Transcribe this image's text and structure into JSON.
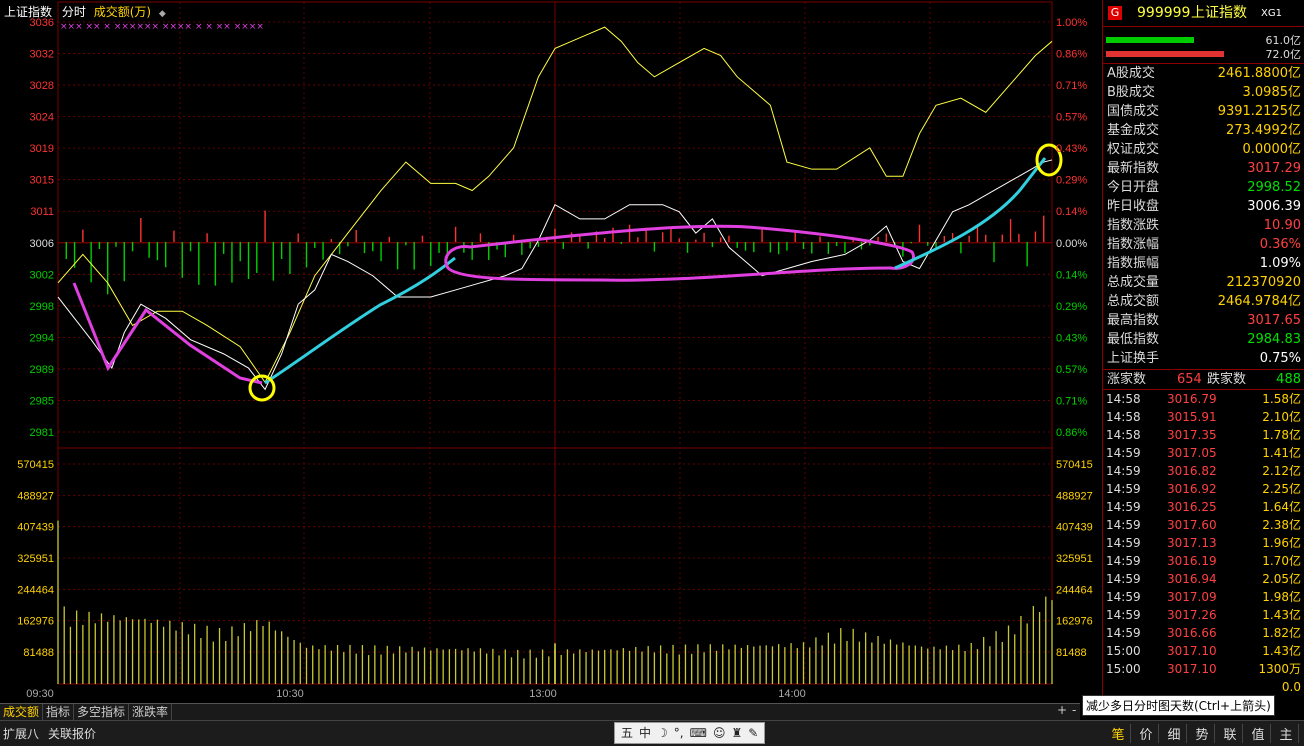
{
  "chart_header": {
    "title": "上证指数",
    "mode": "分时",
    "indicator": "成交额(万)",
    "sort_icon": "up-down-arrows-icon"
  },
  "chart_data": {
    "type": "line",
    "price_axis_ticks": [
      "3036",
      "3032",
      "3028",
      "3024",
      "3019",
      "3015",
      "3011",
      "3006",
      "3002",
      "2998",
      "2994",
      "2989",
      "2985",
      "2981"
    ],
    "pct_axis_ticks": [
      "1.00%",
      "0.86%",
      "0.71%",
      "0.57%",
      "0.43%",
      "0.29%",
      "0.14%",
      "0.00%",
      "0.14%",
      "0.29%",
      "0.43%",
      "0.57%",
      "0.71%",
      "0.86%"
    ],
    "volume_axis_ticks": [
      "570415",
      "488927",
      "407439",
      "325951",
      "244464",
      "162976",
      "81488"
    ],
    "time_labels": [
      "09:30",
      "10:30",
      "13:00",
      "14:00"
    ],
    "prev_close": 3006.39,
    "price_ylim": [
      2979,
      3037
    ],
    "volume_ylim": [
      0,
      595000
    ],
    "x_range": [
      0,
      240
    ],
    "index_line": {
      "x": [
        0,
        8,
        13,
        16,
        20,
        26,
        32,
        40,
        46,
        50,
        54,
        58,
        62,
        66,
        70,
        76,
        82,
        90,
        96,
        102,
        108,
        112,
        116,
        120,
        126,
        132,
        138,
        142,
        146,
        150,
        154,
        158,
        162,
        166,
        170,
        176,
        182,
        190,
        196,
        200,
        204,
        208,
        212,
        216,
        220,
        226,
        232,
        238,
        240
      ],
      "y": [
        2998,
        2992,
        2988,
        2993,
        2997,
        2995,
        2992,
        2990,
        2988,
        2985,
        2990,
        2997,
        2999,
        3004,
        3003,
        3001,
        2998,
        2998,
        2999,
        3000,
        3001,
        3002,
        3006,
        3011,
        3009,
        3009,
        3011,
        3011,
        3011,
        3010,
        3007,
        3009,
        3005,
        3003,
        3001,
        3002,
        3003,
        3004,
        3006,
        3008,
        3003,
        3002,
        3006,
        3010,
        3011,
        3013,
        3015,
        3017,
        3017.3
      ]
    },
    "avg_line": {
      "x": [
        0,
        6,
        12,
        18,
        24,
        30,
        36,
        44,
        50,
        56,
        62,
        70,
        78,
        84,
        90,
        96,
        100,
        104,
        110,
        116,
        120,
        124,
        128,
        132,
        136,
        140,
        144,
        150,
        156,
        160,
        164,
        168,
        172,
        176,
        182,
        188,
        196,
        200,
        204,
        208,
        212,
        218,
        224,
        230,
        236,
        240
      ],
      "y": [
        3000,
        3004,
        3000,
        2994,
        2996,
        2996,
        2994,
        2991,
        2986,
        2993,
        3001,
        3007,
        3013,
        3017,
        3014,
        3014,
        3013,
        3015,
        3019,
        3029,
        3033,
        3034,
        3035,
        3036,
        3034,
        3031,
        3029,
        3031,
        3033,
        3032,
        3029,
        3027,
        3025,
        3017,
        3016,
        3016,
        3019,
        3015,
        3015,
        3021,
        3025,
        3026,
        3024,
        3028,
        3032,
        3034
      ]
    },
    "volume_profile": {
      "x": [
        0,
        1,
        2,
        20,
        40,
        50,
        52,
        56,
        60,
        80,
        100,
        110,
        120,
        140,
        160,
        180,
        190,
        200,
        210,
        220,
        230,
        240
      ],
      "y": [
        520000,
        190000,
        175000,
        165000,
        130000,
        160000,
        145000,
        118000,
        95000,
        90000,
        88000,
        80000,
        82000,
        90000,
        95000,
        100000,
        135000,
        110000,
        92000,
        95000,
        140000,
        225000
      ]
    },
    "volume_spike": {
      "x": 120,
      "y": 110000
    },
    "breadth_bars": "oscillating red/green bars above/below 0.00% line"
  },
  "stars_row": "×××  ×× ×  ××××××  ×××× ×  ×    ××    ××××",
  "side_panel": {
    "badge": "G",
    "code": "999999",
    "name": "上证指数",
    "tag": "XG1",
    "bars": [
      {
        "value": "61.0亿",
        "color": "#00cc00"
      },
      {
        "value": "72.0亿",
        "color": "#e23232"
      }
    ],
    "stats": [
      {
        "label": "A股成交",
        "value": "2461.8800亿",
        "color": "#ffd200"
      },
      {
        "label": "B股成交",
        "value": "3.0985亿",
        "color": "#ffd200"
      },
      {
        "label": "国债成交",
        "value": "9391.2125亿",
        "color": "#ffd200"
      },
      {
        "label": "基金成交",
        "value": "273.4992亿",
        "color": "#ffd200"
      },
      {
        "label": "权证成交",
        "value": "0.0000亿",
        "color": "#ffd200"
      },
      {
        "label": "最新指数",
        "value": "3017.29",
        "color": "#ff4040"
      },
      {
        "label": "今日开盘",
        "value": "2998.52",
        "color": "#00e000"
      },
      {
        "label": "昨日收盘",
        "value": "3006.39",
        "color": "#ffffff"
      },
      {
        "label": "指数涨跌",
        "value": "10.90",
        "color": "#ff4040"
      },
      {
        "label": "指数涨幅",
        "value": "0.36%",
        "color": "#ff4040"
      },
      {
        "label": "指数振幅",
        "value": "1.09%",
        "color": "#ffffff"
      },
      {
        "label": "总成交量",
        "value": "212370920",
        "color": "#ffd200"
      },
      {
        "label": "总成交额",
        "value": "2464.9784亿",
        "color": "#ffd200"
      },
      {
        "label": "最高指数",
        "value": "3017.65",
        "color": "#ff4040"
      },
      {
        "label": "最低指数",
        "value": "2984.83",
        "color": "#00e000"
      },
      {
        "label": "上证换手",
        "value": "0.75%",
        "color": "#ffffff"
      }
    ],
    "breadth": {
      "up_label": "涨家数",
      "up_count": "654",
      "down_label": "跌家数",
      "down_count": "488"
    },
    "ticks": [
      {
        "time": "14:58",
        "price": "3016.79",
        "amount": "1.58亿"
      },
      {
        "time": "14:58",
        "price": "3015.91",
        "amount": "2.10亿"
      },
      {
        "time": "14:58",
        "price": "3017.35",
        "amount": "1.78亿"
      },
      {
        "time": "14:59",
        "price": "3017.05",
        "amount": "1.41亿"
      },
      {
        "time": "14:59",
        "price": "3016.82",
        "amount": "2.12亿"
      },
      {
        "time": "14:59",
        "price": "3016.92",
        "amount": "2.25亿"
      },
      {
        "time": "14:59",
        "price": "3016.25",
        "amount": "1.64亿"
      },
      {
        "time": "14:59",
        "price": "3017.60",
        "amount": "2.38亿"
      },
      {
        "time": "14:59",
        "price": "3017.13",
        "amount": "1.96亿"
      },
      {
        "time": "14:59",
        "price": "3016.19",
        "amount": "1.70亿"
      },
      {
        "time": "14:59",
        "price": "3016.94",
        "amount": "2.05亿"
      },
      {
        "time": "14:59",
        "price": "3017.09",
        "amount": "1.98亿"
      },
      {
        "time": "14:59",
        "price": "3017.26",
        "amount": "1.43亿"
      },
      {
        "time": "14:59",
        "price": "3016.66",
        "amount": "1.82亿"
      },
      {
        "time": "15:00",
        "price": "3017.10",
        "amount": "1.43亿"
      },
      {
        "time": "15:00",
        "price": "3017.10",
        "amount": "1300万"
      }
    ],
    "last_value": "0.0"
  },
  "tooltip": "减少多日分时图天数(Ctrl+上箭头)",
  "tabs": [
    "成交额",
    "指标",
    "多空指标",
    "涨跌率"
  ],
  "tab_controls": [
    "+",
    "-"
  ],
  "bottom": {
    "left": [
      "扩展八",
      "关联报价"
    ],
    "toolbar_icons": [
      "ime-box-icon",
      "chinese-mode-icon",
      "moon-icon",
      "punctuation-icon",
      "keyboard-icon",
      "user-icon",
      "shirt-icon",
      "wrench-icon"
    ],
    "toolbar_glyphs": [
      "五",
      "中",
      "☽",
      "°,",
      "⌨",
      "☺",
      "♜",
      "✎"
    ],
    "right": [
      "笔",
      "价",
      "细",
      "势",
      "联",
      "值",
      "主"
    ]
  },
  "colors": {
    "grid": "#7a0000",
    "up": "#ff3232",
    "down": "#00d000",
    "index": "#ffffff",
    "avg": "#ffff40",
    "annot_pink": "#e040e0",
    "annot_cyan": "#30d0e0",
    "annot_yellow": "#ffff00"
  }
}
